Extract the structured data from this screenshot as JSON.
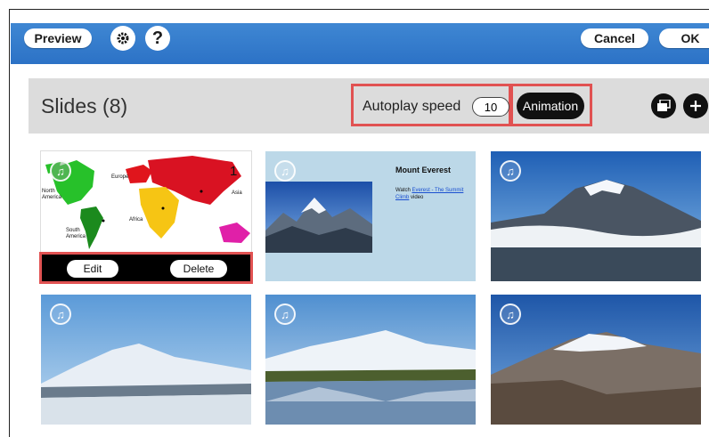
{
  "toolbar": {
    "preview_label": "Preview",
    "cancel_label": "Cancel",
    "ok_label": "OK",
    "settings_icon": "gear-icon",
    "help_icon": "help-icon",
    "help_glyph": "?"
  },
  "header": {
    "title": "Slides (8)",
    "autoplay_label": "Autoplay speed",
    "autoplay_value": "10",
    "animation_label": "Animation",
    "gallery_icon": "slides-stack-icon",
    "add_icon": "plus-icon"
  },
  "slides": [
    {
      "kind": "map",
      "number": "1",
      "labels": [
        "Europe",
        "North America",
        "Asia",
        "Africa",
        "South America"
      ],
      "edit_label": "Edit",
      "delete_label": "Delete"
    },
    {
      "kind": "text-image",
      "heading": "Mount Everest",
      "text_prefix": "Watch ",
      "link": "Everest - The Summit Climb",
      "text_suffix": " video"
    },
    {
      "kind": "photo",
      "subject": "Kilimanjaro"
    },
    {
      "kind": "photo",
      "subject": "Denali snowfield"
    },
    {
      "kind": "photo",
      "subject": "Denali with lake"
    },
    {
      "kind": "photo",
      "subject": "Aconcagua"
    }
  ],
  "colors": {
    "toolbar": "#3579cc",
    "header_bg": "#dcdcdc",
    "highlight": "#e15252"
  }
}
